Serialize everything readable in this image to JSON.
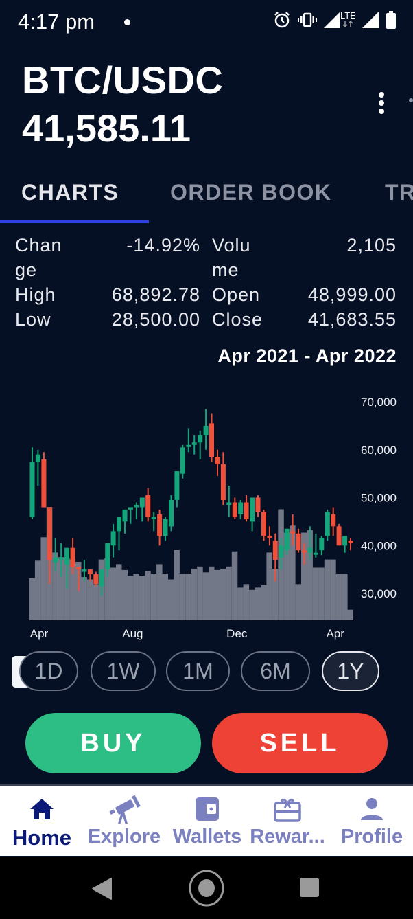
{
  "status_bar": {
    "time": "4:17 pm",
    "icons": [
      "notification-dot",
      "alarm-icon",
      "vibrate-icon",
      "signal-icon",
      "lte-icon",
      "signal-icon",
      "battery-icon"
    ],
    "network": "LTE"
  },
  "header": {
    "pair": "BTC/USDC",
    "price": "41,585.11",
    "menu_icon": "more-vertical-icon"
  },
  "tabs": [
    {
      "label": "CHARTS",
      "active": true
    },
    {
      "label": "ORDER BOOK",
      "active": false
    },
    {
      "label": "TR",
      "active": false
    }
  ],
  "stats": {
    "change_label_1": "Chan",
    "change_label_2": "ge",
    "change_value": "-14.92%",
    "volume_label_1": "Volu",
    "volume_label_2": "me",
    "volume_value": "2,105",
    "high_label": "High",
    "high_value": "68,892.78",
    "open_label": "Open",
    "open_value": "48,999.00",
    "low_label": "Low",
    "low_value": "28,500.00",
    "close_label": "Close",
    "close_value": "41,683.55"
  },
  "range_label": "Apr 2021 - Apr 2022",
  "colors": {
    "up": "#15a57a",
    "down": "#f0503a",
    "volume": "#727887",
    "background": "#061024",
    "tab_indicator": "#2f3fe0",
    "buy": "#2dbe86",
    "sell": "#ee4236",
    "nav_active": "#0b1a78",
    "nav_inactive": "#7b80c0"
  },
  "chart_data": {
    "type": "candlestick",
    "title": "BTC/USDC",
    "xlabel": "",
    "ylabel": "",
    "ylim": [
      25000,
      72500
    ],
    "y_ticks": [
      30000,
      40000,
      50000,
      60000,
      70000
    ],
    "y_tick_labels": [
      "30,000",
      "40,000",
      "50,000",
      "60,000",
      "70,000"
    ],
    "x_tick_labels": [
      {
        "label": "Apr",
        "index": 0
      },
      {
        "label": "Aug",
        "index": 17
      },
      {
        "label": "Dec",
        "index": 35
      },
      {
        "label": "Apr",
        "index": 52
      }
    ],
    "grid": false,
    "volume_scale_max": 100,
    "candles": [
      {
        "o": 46.0,
        "h": 60.5,
        "l": 45.5,
        "c": 57.5,
        "v": 36
      },
      {
        "o": 57.5,
        "h": 60.0,
        "l": 52.5,
        "c": 59.0,
        "v": 51
      },
      {
        "o": 58.0,
        "h": 59.5,
        "l": 50.0,
        "c": 48.0,
        "v": 71
      },
      {
        "o": 48.0,
        "h": 40.5,
        "l": 32.0,
        "c": 37.0,
        "v": 97
      },
      {
        "o": 36.5,
        "h": 41.5,
        "l": 34.5,
        "c": 37.5,
        "v": 58
      },
      {
        "o": 37.0,
        "h": 40.5,
        "l": 33.5,
        "c": 37.5,
        "v": 54
      },
      {
        "o": 36.0,
        "h": 39.0,
        "l": 31.0,
        "c": 39.5,
        "v": 53
      },
      {
        "o": 39.5,
        "h": 41.5,
        "l": 34.0,
        "c": 35.5,
        "v": 52
      },
      {
        "o": 35.5,
        "h": 35.5,
        "l": 30.5,
        "c": 35.0,
        "v": 50
      },
      {
        "o": 34.5,
        "h": 37.0,
        "l": 32.5,
        "c": 35.0,
        "v": 37
      },
      {
        "o": 35.0,
        "h": 35.0,
        "l": 32.5,
        "c": 34.0,
        "v": 35
      },
      {
        "o": 34.0,
        "h": 34.5,
        "l": 31.5,
        "c": 32.0,
        "v": 31
      },
      {
        "o": 31.5,
        "h": 35.0,
        "l": 29.5,
        "c": 35.0,
        "v": 52
      },
      {
        "o": 35.0,
        "h": 40.5,
        "l": 33.5,
        "c": 40.5,
        "v": 53
      },
      {
        "o": 40.0,
        "h": 44.5,
        "l": 37.5,
        "c": 43.0,
        "v": 45
      },
      {
        "o": 43.0,
        "h": 46.0,
        "l": 39.0,
        "c": 46.0,
        "v": 48
      },
      {
        "o": 45.0,
        "h": 47.5,
        "l": 42.5,
        "c": 47.5,
        "v": 43
      },
      {
        "o": 47.5,
        "h": 48.0,
        "l": 44.5,
        "c": 48.0,
        "v": 38
      },
      {
        "o": 48.0,
        "h": 49.0,
        "l": 45.5,
        "c": 48.5,
        "v": 40
      },
      {
        "o": 48.0,
        "h": 50.0,
        "l": 45.0,
        "c": 50.0,
        "v": 38
      },
      {
        "o": 50.5,
        "h": 52.0,
        "l": 45.0,
        "c": 46.0,
        "v": 42
      },
      {
        "o": 45.5,
        "h": 47.0,
        "l": 43.0,
        "c": 46.0,
        "v": 40
      },
      {
        "o": 46.5,
        "h": 47.5,
        "l": 40.0,
        "c": 42.0,
        "v": 48
      },
      {
        "o": 42.0,
        "h": 46.0,
        "l": 41.0,
        "c": 45.5,
        "v": 40
      },
      {
        "o": 44.0,
        "h": 50.5,
        "l": 43.0,
        "c": 49.5,
        "v": 35
      },
      {
        "o": 49.5,
        "h": 55.5,
        "l": 48.0,
        "c": 55.5,
        "v": 60
      },
      {
        "o": 55.0,
        "h": 61.0,
        "l": 54.0,
        "c": 60.5,
        "v": 40
      },
      {
        "o": 61.0,
        "h": 64.5,
        "l": 59.5,
        "c": 61.0,
        "v": 40
      },
      {
        "o": 61.0,
        "h": 63.0,
        "l": 59.0,
        "c": 61.5,
        "v": 44
      },
      {
        "o": 61.5,
        "h": 64.0,
        "l": 58.0,
        "c": 63.0,
        "v": 46
      },
      {
        "o": 63.0,
        "h": 68.5,
        "l": 60.0,
        "c": 65.0,
        "v": 41
      },
      {
        "o": 65.5,
        "h": 67.5,
        "l": 57.5,
        "c": 58.5,
        "v": 46
      },
      {
        "o": 58.5,
        "h": 60.0,
        "l": 54.5,
        "c": 57.0,
        "v": 43
      },
      {
        "o": 57.0,
        "h": 59.5,
        "l": 48.5,
        "c": 49.5,
        "v": 44
      },
      {
        "o": 48.5,
        "h": 52.5,
        "l": 46.0,
        "c": 49.0,
        "v": 46
      },
      {
        "o": 49.0,
        "h": 50.0,
        "l": 45.5,
        "c": 46.0,
        "v": 59
      },
      {
        "o": 46.5,
        "h": 49.5,
        "l": 45.5,
        "c": 49.0,
        "v": 28
      },
      {
        "o": 49.0,
        "h": 50.5,
        "l": 45.0,
        "c": 45.5,
        "v": 31
      },
      {
        "o": 45.0,
        "h": 48.0,
        "l": 43.0,
        "c": 50.0,
        "v": 26
      },
      {
        "o": 50.0,
        "h": 50.5,
        "l": 46.0,
        "c": 47.0,
        "v": 28
      },
      {
        "o": 47.0,
        "h": 47.5,
        "l": 41.0,
        "c": 42.0,
        "v": 30
      },
      {
        "o": 42.0,
        "h": 44.0,
        "l": 40.0,
        "c": 41.5,
        "v": 58
      },
      {
        "o": 41.0,
        "h": 42.5,
        "l": 32.5,
        "c": 37.0,
        "v": 44
      },
      {
        "o": 37.5,
        "h": 41.5,
        "l": 35.0,
        "c": 40.0,
        "v": 95
      },
      {
        "o": 39.0,
        "h": 43.5,
        "l": 38.0,
        "c": 43.5,
        "v": 75
      },
      {
        "o": 43.0,
        "h": 46.5,
        "l": 40.0,
        "c": 42.5,
        "v": 81
      },
      {
        "o": 42.5,
        "h": 43.5,
        "l": 38.5,
        "c": 39.0,
        "v": 31
      },
      {
        "o": 39.0,
        "h": 40.5,
        "l": 36.0,
        "c": 38.5,
        "v": 75
      },
      {
        "o": 38.5,
        "h": 44.0,
        "l": 37.0,
        "c": 39.5,
        "v": 77
      },
      {
        "o": 38.5,
        "h": 42.5,
        "l": 37.5,
        "c": 38.5,
        "v": 45
      },
      {
        "o": 39.0,
        "h": 42.0,
        "l": 38.0,
        "c": 41.5,
        "v": 45
      },
      {
        "o": 42.0,
        "h": 47.5,
        "l": 41.0,
        "c": 47.0,
        "v": 52
      },
      {
        "o": 46.5,
        "h": 48.0,
        "l": 42.0,
        "c": 44.0,
        "v": 52
      },
      {
        "o": 44.0,
        "h": 44.5,
        "l": 40.0,
        "c": 40.0,
        "v": 40
      },
      {
        "o": 40.0,
        "h": 41.5,
        "l": 38.5,
        "c": 42.0,
        "v": 40
      },
      {
        "o": 41.0,
        "h": 41.5,
        "l": 39.0,
        "c": 40.5,
        "v": 9
      }
    ]
  },
  "time_ranges": [
    {
      "label": "1D",
      "active": false
    },
    {
      "label": "1W",
      "active": false
    },
    {
      "label": "1M",
      "active": false
    },
    {
      "label": "6M",
      "active": false
    },
    {
      "label": "1Y",
      "active": true
    }
  ],
  "actions": {
    "buy_label": "BUY",
    "sell_label": "SELL"
  },
  "bottom_nav": [
    {
      "label": "Home",
      "icon": "home-icon",
      "active": true
    },
    {
      "label": "Explore",
      "icon": "telescope-icon",
      "active": false
    },
    {
      "label": "Wallets",
      "icon": "wallet-icon",
      "active": false
    },
    {
      "label": "Rewar...",
      "icon": "gift-card-icon",
      "active": false
    },
    {
      "label": "Profile",
      "icon": "person-icon",
      "active": false
    }
  ],
  "system_nav": [
    "back-icon",
    "home-circle-icon",
    "recents-icon"
  ]
}
